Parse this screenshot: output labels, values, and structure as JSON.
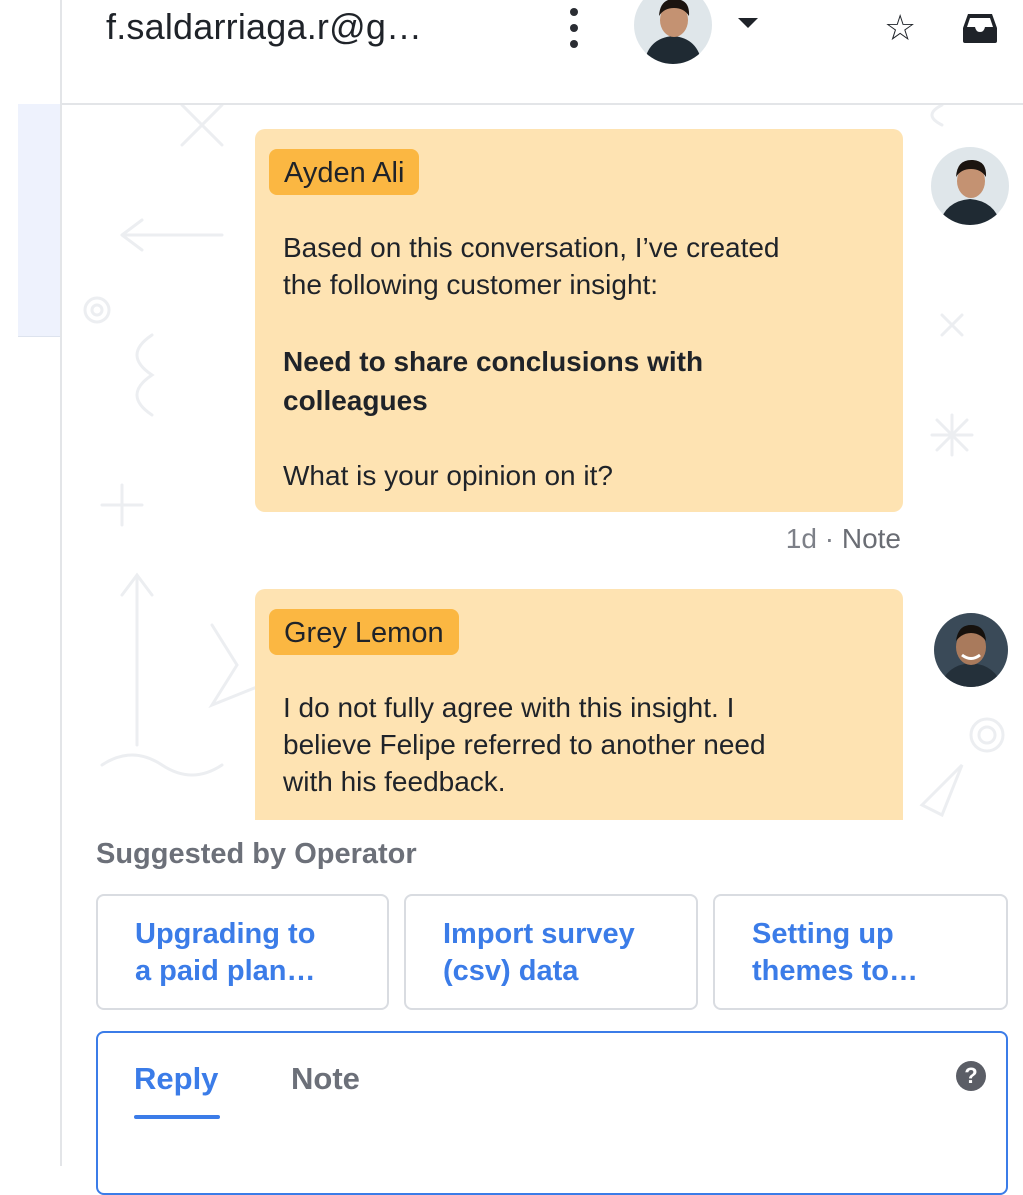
{
  "header": {
    "contact_name": "f.saldarriaga.r@g…",
    "more_icon": "kebab-menu-icon",
    "assignee_icon": "avatar",
    "dropdown_icon": "caret-down-icon",
    "star_icon": "star-outline-icon",
    "inbox_icon": "inbox-tray-icon"
  },
  "messages": [
    {
      "author": "Ayden Ali",
      "line1": "Based on this conversation, I’ve created",
      "line2": "the following customer insight:",
      "insight1": "Need to share conclusions with",
      "insight2": "colleagues",
      "question": "What is your opinion on it?",
      "time": "1d",
      "separator": "·",
      "type": "Note"
    },
    {
      "author": "Grey Lemon",
      "line1": "I do not fully agree with this insight. I",
      "line2": "believe Felipe referred to another need",
      "line3": "with his feedback."
    }
  ],
  "suggestions": {
    "title": "Suggested by Operator",
    "items": [
      {
        "line1": "Upgrading to",
        "line2": "a paid plan…"
      },
      {
        "line1": "Import survey",
        "line2": "(csv) data"
      },
      {
        "line1": "Setting up",
        "line2": "themes to…"
      }
    ]
  },
  "composer": {
    "tab_reply": "Reply",
    "tab_note": "Note",
    "help": "?"
  },
  "colors": {
    "accent": "#3b7ce8",
    "note_bubble": "#fee3b2",
    "author_tag": "#fbb742"
  }
}
